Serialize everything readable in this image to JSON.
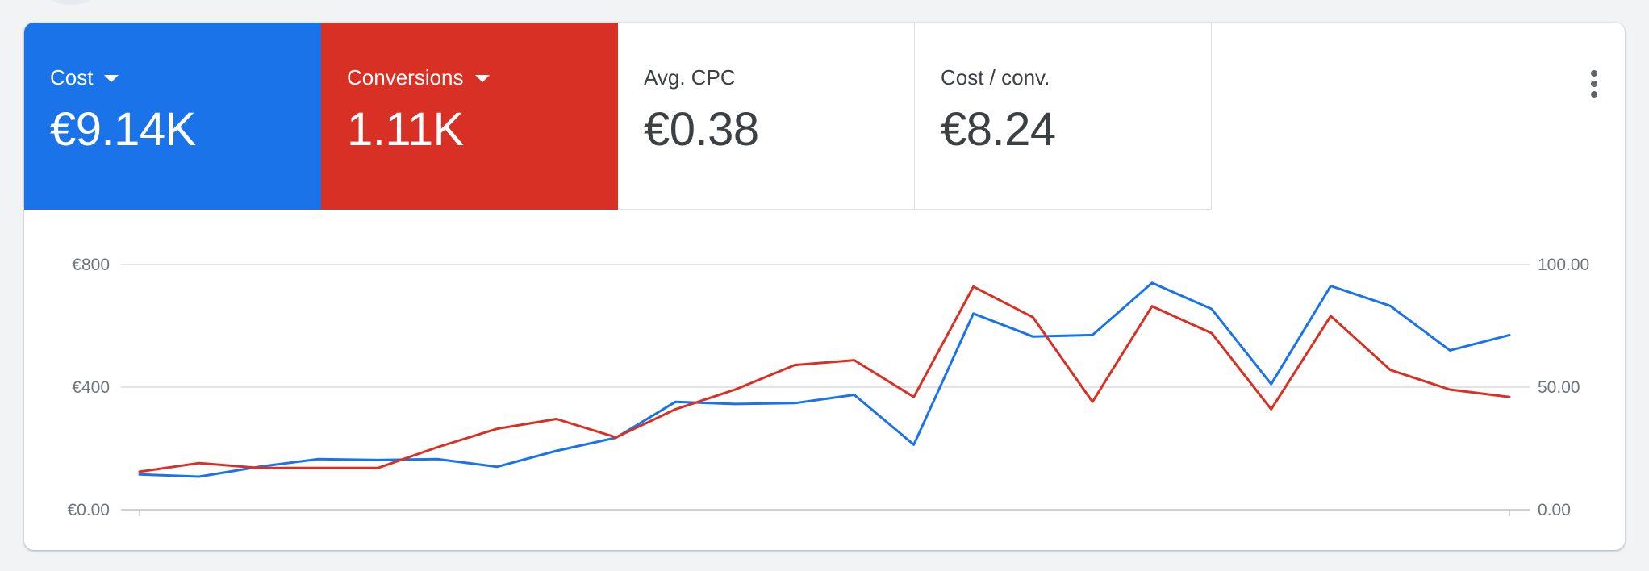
{
  "colors": {
    "cost": "#1a73e8",
    "conversions": "#d93025",
    "grid": "#dadce0",
    "axis_text": "#70757a"
  },
  "tiles": [
    {
      "label": "Cost",
      "value": "€9.14K",
      "dropdown": true,
      "color": "#1a73e8"
    },
    {
      "label": "Conversions",
      "value": "1.11K",
      "dropdown": true,
      "color": "#d93025"
    },
    {
      "label": "Avg. CPC",
      "value": "€0.38",
      "dropdown": false
    },
    {
      "label": "Cost / conv.",
      "value": "€8.24",
      "dropdown": false
    }
  ],
  "menu": {
    "icon": "more-vert-icon"
  },
  "chart_data": {
    "type": "line",
    "left_axis": {
      "ticks": [
        "€0.00",
        "€400",
        "€800"
      ],
      "range": [
        0,
        800
      ]
    },
    "right_axis": {
      "ticks": [
        "0.00",
        "50.00",
        "100.00"
      ],
      "range": [
        0,
        100
      ]
    },
    "grid": true,
    "series": [
      {
        "name": "Cost",
        "axis": "left",
        "color": "#1a73e8",
        "values": [
          115,
          108,
          140,
          165,
          162,
          165,
          140,
          192,
          235,
          352,
          345,
          348,
          375,
          212,
          640,
          565,
          570,
          740,
          655,
          410,
          730,
          665,
          520,
          570
        ]
      },
      {
        "name": "Conversions",
        "axis": "right",
        "color": "#d93025",
        "values": [
          15.5,
          19,
          17,
          17,
          17,
          25.5,
          33,
          37,
          29.5,
          41,
          49,
          59,
          61,
          46,
          91,
          78.5,
          44,
          83,
          72,
          41,
          79,
          57,
          49,
          46
        ]
      }
    ]
  }
}
